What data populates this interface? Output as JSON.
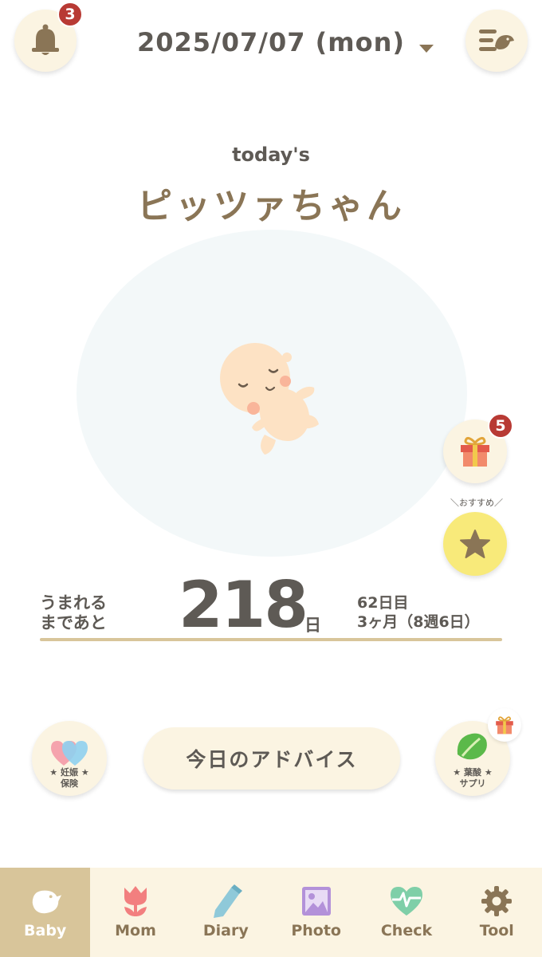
{
  "header": {
    "notifications_badge": "3",
    "date": "2025/07/07 (mon)",
    "bell_icon": "bell-icon",
    "menu_icon": "menu-bird-icon"
  },
  "main": {
    "today_label": "today's",
    "baby_name": "ピッツァちゃん",
    "illustration": "sleeping-baby"
  },
  "side_buttons": {
    "gift_badge": "5",
    "recommend_label": "＼おすすめ／"
  },
  "countdown": {
    "label_line1": "うまれる",
    "label_line2": "まであと",
    "days": "218",
    "unit": "日",
    "day_count": "62日目",
    "month_week": "3ヶ月（8週6日）"
  },
  "actions": {
    "insurance_line1": "★ 妊娠 ★",
    "insurance_line2": "保険",
    "advice_button": "今日のアドバイス",
    "supplement_line1": "★ 葉酸 ★",
    "supplement_line2": "サプリ"
  },
  "tabbar": {
    "tabs": [
      {
        "label": "Baby",
        "icon": "bird-icon",
        "active": true
      },
      {
        "label": "Mom",
        "icon": "tulip-icon"
      },
      {
        "label": "Diary",
        "icon": "pencil-icon"
      },
      {
        "label": "Photo",
        "icon": "photo-icon"
      },
      {
        "label": "Check",
        "icon": "heartbeat-icon"
      },
      {
        "label": "Tool",
        "icon": "gear-icon"
      }
    ]
  },
  "colors": {
    "accent_brown": "#8a7556",
    "cream": "#fbf4e2",
    "tab_active": "#d8c59a",
    "badge_red": "#b83a34",
    "star_yellow": "#f8ea7a"
  }
}
